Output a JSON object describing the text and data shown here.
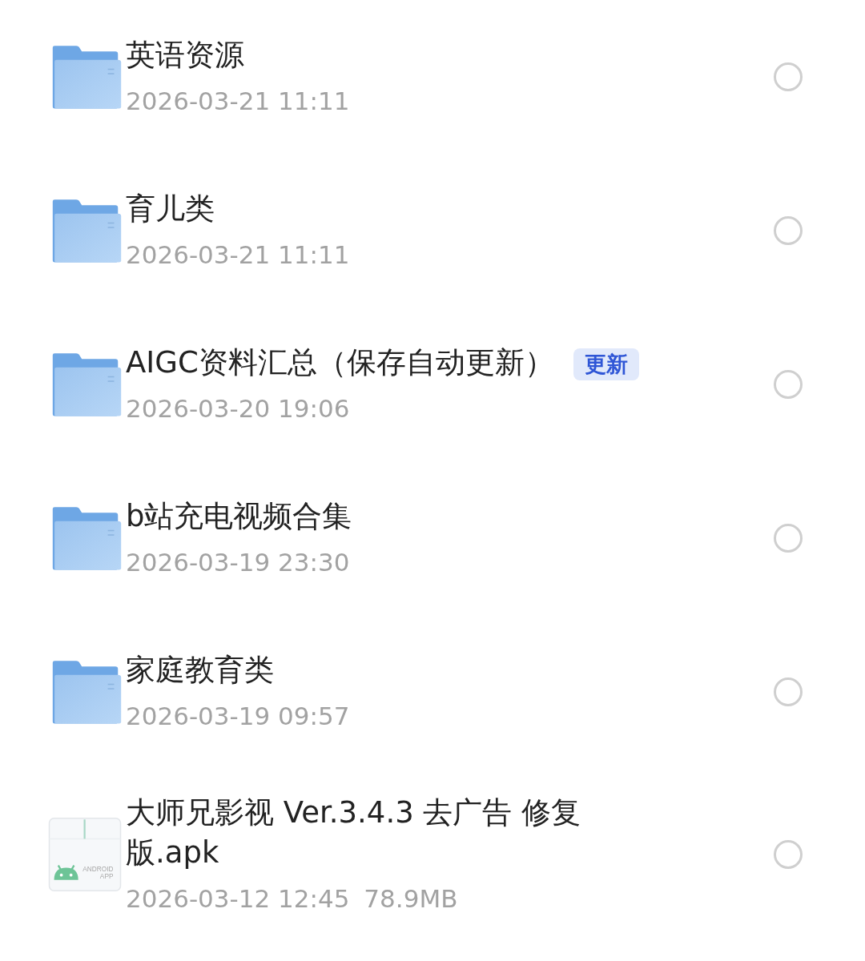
{
  "items": [
    {
      "kind": "folder",
      "name": "英语资源",
      "date": "2026-03-21 11:11",
      "selected": false
    },
    {
      "kind": "folder",
      "name": "育儿类",
      "date": "2026-03-21 11:11",
      "selected": false
    },
    {
      "kind": "folder",
      "name": "AIGC资料汇总（保存自动更新）",
      "badge": "更新",
      "date": "2026-03-20 19:06",
      "selected": false
    },
    {
      "kind": "folder",
      "name": "b站充电视频合集",
      "date": "2026-03-19 23:30",
      "selected": false
    },
    {
      "kind": "folder",
      "name": "家庭教育类",
      "date": "2026-03-19 09:57",
      "selected": false
    },
    {
      "kind": "apk",
      "name": "大师兄影视 Ver.3.4.3 去广告 修复版.apk",
      "icon_text": [
        "ANDROID",
        "APP"
      ],
      "date": "2026-03-12 12:45",
      "size": "78.9MB",
      "selected": false
    }
  ]
}
